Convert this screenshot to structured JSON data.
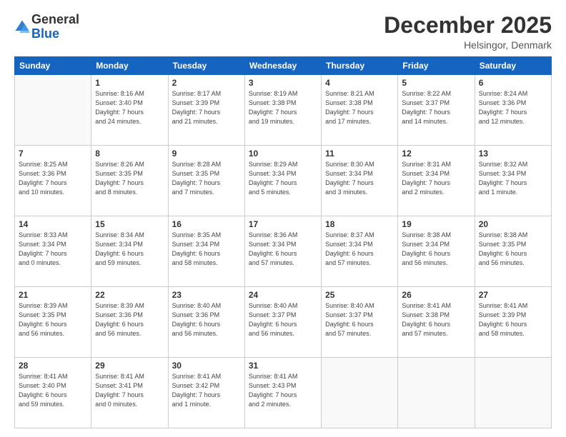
{
  "logo": {
    "general": "General",
    "blue": "Blue"
  },
  "header": {
    "title": "December 2025",
    "location": "Helsingor, Denmark"
  },
  "weekdays": [
    "Sunday",
    "Monday",
    "Tuesday",
    "Wednesday",
    "Thursday",
    "Friday",
    "Saturday"
  ],
  "weeks": [
    [
      {
        "day": "",
        "info": ""
      },
      {
        "day": "1",
        "info": "Sunrise: 8:16 AM\nSunset: 3:40 PM\nDaylight: 7 hours\nand 24 minutes."
      },
      {
        "day": "2",
        "info": "Sunrise: 8:17 AM\nSunset: 3:39 PM\nDaylight: 7 hours\nand 21 minutes."
      },
      {
        "day": "3",
        "info": "Sunrise: 8:19 AM\nSunset: 3:38 PM\nDaylight: 7 hours\nand 19 minutes."
      },
      {
        "day": "4",
        "info": "Sunrise: 8:21 AM\nSunset: 3:38 PM\nDaylight: 7 hours\nand 17 minutes."
      },
      {
        "day": "5",
        "info": "Sunrise: 8:22 AM\nSunset: 3:37 PM\nDaylight: 7 hours\nand 14 minutes."
      },
      {
        "day": "6",
        "info": "Sunrise: 8:24 AM\nSunset: 3:36 PM\nDaylight: 7 hours\nand 12 minutes."
      }
    ],
    [
      {
        "day": "7",
        "info": "Sunrise: 8:25 AM\nSunset: 3:36 PM\nDaylight: 7 hours\nand 10 minutes."
      },
      {
        "day": "8",
        "info": "Sunrise: 8:26 AM\nSunset: 3:35 PM\nDaylight: 7 hours\nand 8 minutes."
      },
      {
        "day": "9",
        "info": "Sunrise: 8:28 AM\nSunset: 3:35 PM\nDaylight: 7 hours\nand 7 minutes."
      },
      {
        "day": "10",
        "info": "Sunrise: 8:29 AM\nSunset: 3:34 PM\nDaylight: 7 hours\nand 5 minutes."
      },
      {
        "day": "11",
        "info": "Sunrise: 8:30 AM\nSunset: 3:34 PM\nDaylight: 7 hours\nand 3 minutes."
      },
      {
        "day": "12",
        "info": "Sunrise: 8:31 AM\nSunset: 3:34 PM\nDaylight: 7 hours\nand 2 minutes."
      },
      {
        "day": "13",
        "info": "Sunrise: 8:32 AM\nSunset: 3:34 PM\nDaylight: 7 hours\nand 1 minute."
      }
    ],
    [
      {
        "day": "14",
        "info": "Sunrise: 8:33 AM\nSunset: 3:34 PM\nDaylight: 7 hours\nand 0 minutes."
      },
      {
        "day": "15",
        "info": "Sunrise: 8:34 AM\nSunset: 3:34 PM\nDaylight: 6 hours\nand 59 minutes."
      },
      {
        "day": "16",
        "info": "Sunrise: 8:35 AM\nSunset: 3:34 PM\nDaylight: 6 hours\nand 58 minutes."
      },
      {
        "day": "17",
        "info": "Sunrise: 8:36 AM\nSunset: 3:34 PM\nDaylight: 6 hours\nand 57 minutes."
      },
      {
        "day": "18",
        "info": "Sunrise: 8:37 AM\nSunset: 3:34 PM\nDaylight: 6 hours\nand 57 minutes."
      },
      {
        "day": "19",
        "info": "Sunrise: 8:38 AM\nSunset: 3:34 PM\nDaylight: 6 hours\nand 56 minutes."
      },
      {
        "day": "20",
        "info": "Sunrise: 8:38 AM\nSunset: 3:35 PM\nDaylight: 6 hours\nand 56 minutes."
      }
    ],
    [
      {
        "day": "21",
        "info": "Sunrise: 8:39 AM\nSunset: 3:35 PM\nDaylight: 6 hours\nand 56 minutes."
      },
      {
        "day": "22",
        "info": "Sunrise: 8:39 AM\nSunset: 3:36 PM\nDaylight: 6 hours\nand 56 minutes."
      },
      {
        "day": "23",
        "info": "Sunrise: 8:40 AM\nSunset: 3:36 PM\nDaylight: 6 hours\nand 56 minutes."
      },
      {
        "day": "24",
        "info": "Sunrise: 8:40 AM\nSunset: 3:37 PM\nDaylight: 6 hours\nand 56 minutes."
      },
      {
        "day": "25",
        "info": "Sunrise: 8:40 AM\nSunset: 3:37 PM\nDaylight: 6 hours\nand 57 minutes."
      },
      {
        "day": "26",
        "info": "Sunrise: 8:41 AM\nSunset: 3:38 PM\nDaylight: 6 hours\nand 57 minutes."
      },
      {
        "day": "27",
        "info": "Sunrise: 8:41 AM\nSunset: 3:39 PM\nDaylight: 6 hours\nand 58 minutes."
      }
    ],
    [
      {
        "day": "28",
        "info": "Sunrise: 8:41 AM\nSunset: 3:40 PM\nDaylight: 6 hours\nand 59 minutes."
      },
      {
        "day": "29",
        "info": "Sunrise: 8:41 AM\nSunset: 3:41 PM\nDaylight: 7 hours\nand 0 minutes."
      },
      {
        "day": "30",
        "info": "Sunrise: 8:41 AM\nSunset: 3:42 PM\nDaylight: 7 hours\nand 1 minute."
      },
      {
        "day": "31",
        "info": "Sunrise: 8:41 AM\nSunset: 3:43 PM\nDaylight: 7 hours\nand 2 minutes."
      },
      {
        "day": "",
        "info": ""
      },
      {
        "day": "",
        "info": ""
      },
      {
        "day": "",
        "info": ""
      }
    ]
  ]
}
